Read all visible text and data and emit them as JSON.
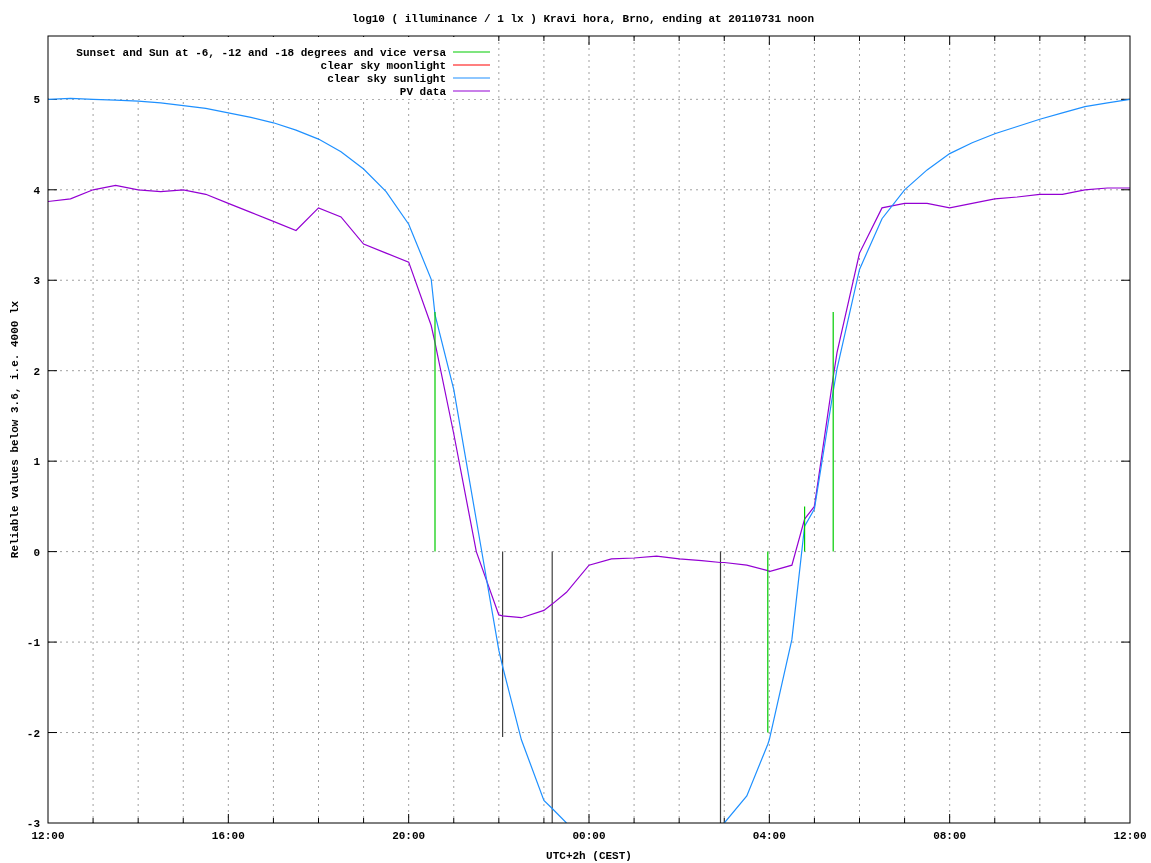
{
  "chart_data": {
    "type": "line",
    "title": "log10 ( illuminance / 1 lx ) Kravi hora, Brno, ending at 20110731 noon",
    "xlabel": "UTC+2h (CEST)",
    "ylabel": "Reliable values below 3.6, i.e. 4000 lx",
    "x": [
      "2011-07-30 12:00",
      "2011-07-30 12:30",
      "2011-07-30 13:00",
      "2011-07-30 13:30",
      "2011-07-30 14:00",
      "2011-07-30 14:30",
      "2011-07-30 15:00",
      "2011-07-30 15:30",
      "2011-07-30 16:00",
      "2011-07-30 16:30",
      "2011-07-30 17:00",
      "2011-07-30 17:30",
      "2011-07-30 18:00",
      "2011-07-30 18:30",
      "2011-07-30 19:00",
      "2011-07-30 19:30",
      "2011-07-30 20:00",
      "2011-07-30 20:30",
      "2011-07-30 20:35",
      "2011-07-30 20:35",
      "2011-07-30 21:00",
      "2011-07-30 21:30",
      "2011-07-30 22:00",
      "2011-07-30 22:05",
      "2011-07-30 22:05",
      "2011-07-30 22:30",
      "2011-07-30 23:00",
      "2011-07-30 23:11",
      "2011-07-30 23:11",
      "2011-07-30 23:30",
      "2011-07-31 00:00",
      "2011-07-31 00:30",
      "2011-07-31 01:00",
      "2011-07-31 01:30",
      "2011-07-31 02:00",
      "2011-07-31 02:30",
      "2011-07-31 02:55",
      "2011-07-31 02:55",
      "2011-07-31 03:00",
      "2011-07-31 03:30",
      "2011-07-31 03:58",
      "2011-07-31 03:58",
      "2011-07-31 04:00",
      "2011-07-31 04:30",
      "2011-07-31 04:47",
      "2011-07-31 04:47",
      "2011-07-31 05:00",
      "2011-07-31 05:25",
      "2011-07-31 05:25",
      "2011-07-31 05:30",
      "2011-07-31 06:00",
      "2011-07-31 06:30",
      "2011-07-31 07:00",
      "2011-07-31 07:30",
      "2011-07-31 08:00",
      "2011-07-31 08:30",
      "2011-07-31 09:00",
      "2011-07-31 09:30",
      "2011-07-31 10:00",
      "2011-07-31 10:30",
      "2011-07-31 11:00",
      "2011-07-31 11:30",
      "2011-07-31 12:00"
    ],
    "xlim": [
      "2011-07-30 12:00",
      "2011-07-31 12:00"
    ],
    "ylim": [
      -3,
      5.7
    ],
    "xticks": [
      {
        "value": "2011-07-30 12:00",
        "label": "12:00"
      },
      {
        "value": "2011-07-30 16:00",
        "label": "16:00"
      },
      {
        "value": "2011-07-30 20:00",
        "label": "20:00"
      },
      {
        "value": "2011-07-31 00:00",
        "label": "00:00"
      },
      {
        "value": "2011-07-31 04:00",
        "label": "04:00"
      },
      {
        "value": "2011-07-31 08:00",
        "label": "08:00"
      },
      {
        "value": "2011-07-31 12:00",
        "label": "12:00"
      }
    ],
    "yticks": [
      -3,
      -2,
      -1,
      0,
      1,
      2,
      3,
      4,
      5
    ],
    "grid": true,
    "legend": true,
    "series": [
      {
        "name": "Sunset and Sun at -6, -12 and -18 degrees and vice versa",
        "color": "#00cc00",
        "values": [
          null,
          null,
          null,
          null,
          null,
          null,
          null,
          null,
          null,
          null,
          null,
          null,
          null,
          null,
          null,
          null,
          null,
          null,
          0,
          2.65,
          null,
          null,
          null,
          null,
          null,
          null,
          null,
          null,
          null,
          null,
          null,
          null,
          null,
          null,
          null,
          null,
          null,
          null,
          null,
          null,
          0,
          -2.0,
          null,
          null,
          0,
          0.5,
          null,
          0,
          2.65,
          null,
          null,
          null,
          null,
          null,
          null,
          null,
          null,
          null,
          null,
          null,
          null,
          null,
          null
        ]
      },
      {
        "name": "clear sky moonlight",
        "color": "#ff0000",
        "values": [
          null,
          null,
          null,
          null,
          null,
          null,
          null,
          null,
          null,
          null,
          null,
          null,
          null,
          null,
          null,
          null,
          null,
          null,
          null,
          null,
          null,
          null,
          null,
          null,
          null,
          null,
          null,
          null,
          null,
          null,
          null,
          null,
          null,
          null,
          null,
          null,
          null,
          null,
          null,
          null,
          null,
          null,
          null,
          null,
          null,
          null,
          null,
          null,
          null,
          null,
          null,
          null,
          null,
          null,
          null,
          null,
          null,
          null,
          null,
          null,
          null,
          null,
          null
        ]
      },
      {
        "name": "clear sky sunlight",
        "color": "#1e90ff",
        "values": [
          5.0,
          5.01,
          5.0,
          4.99,
          4.98,
          4.96,
          4.93,
          4.9,
          4.85,
          4.8,
          4.74,
          4.66,
          4.56,
          4.42,
          4.23,
          3.98,
          3.62,
          3.01,
          2.62,
          2.62,
          1.79,
          0.35,
          -1.09,
          -1.27,
          -1.27,
          -2.08,
          -2.75,
          -2.84,
          -2.84,
          -3.0,
          null,
          null,
          null,
          null,
          null,
          null,
          null,
          null,
          -3.0,
          -2.7,
          -2.13,
          -2.13,
          -2.08,
          -0.97,
          0.28,
          0.28,
          0.47,
          1.77,
          1.77,
          2.02,
          3.12,
          3.68,
          4.0,
          4.22,
          4.4,
          4.52,
          4.62,
          4.7,
          4.78,
          4.85,
          4.92,
          4.96,
          5.0
        ]
      },
      {
        "name": "PV data",
        "color": "#9400d3",
        "values": [
          3.87,
          3.9,
          4.0,
          4.05,
          4.0,
          3.98,
          4.0,
          3.95,
          3.85,
          3.75,
          3.65,
          3.55,
          3.8,
          3.7,
          3.4,
          3.3,
          3.2,
          2.5,
          2.31,
          2.31,
          1.3,
          0.0,
          -0.7,
          -0.71,
          -0.71,
          -0.73,
          -0.65,
          -0.58,
          -0.58,
          -0.45,
          -0.15,
          -0.08,
          -0.07,
          -0.05,
          -0.08,
          -0.1,
          -0.12,
          -0.12,
          -0.12,
          -0.15,
          -0.21,
          -0.21,
          -0.22,
          -0.15,
          0.36,
          0.36,
          0.5,
          1.93,
          1.93,
          2.2,
          3.3,
          3.8,
          3.85,
          3.85,
          3.8,
          3.85,
          3.9,
          3.92,
          3.95,
          3.95,
          4.0,
          4.02,
          4.02
        ]
      },
      {
        "color": "#404040",
        "values": [
          null,
          null,
          null,
          null,
          null,
          null,
          null,
          null,
          null,
          null,
          null,
          null,
          null,
          null,
          null,
          null,
          null,
          null,
          null,
          null,
          null,
          null,
          null,
          0,
          -2.05,
          null,
          null,
          0,
          -3.0,
          null,
          null,
          null,
          null,
          null,
          null,
          null,
          0,
          -3.0,
          null,
          null,
          null,
          null,
          null,
          null,
          null,
          null,
          null,
          null,
          null,
          null,
          null,
          null,
          null,
          null,
          null,
          null,
          null,
          null,
          null,
          null,
          null,
          null,
          null
        ]
      }
    ]
  }
}
